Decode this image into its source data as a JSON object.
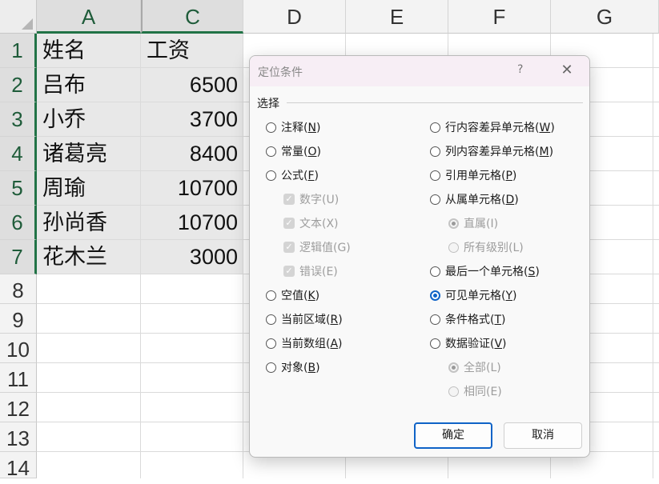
{
  "sheet": {
    "columns": [
      "A",
      "C",
      "D",
      "E",
      "F",
      "G"
    ],
    "rows": [
      "1",
      "2",
      "3",
      "4",
      "5",
      "6",
      "7",
      "8",
      "9",
      "10",
      "11",
      "12",
      "13",
      "14"
    ],
    "data": [
      {
        "name": "姓名",
        "salary": "工资"
      },
      {
        "name": "吕布",
        "salary": "6500"
      },
      {
        "name": "小乔",
        "salary": "3700"
      },
      {
        "name": "诸葛亮",
        "salary": "8400"
      },
      {
        "name": "周瑜",
        "salary": "10700"
      },
      {
        "name": "孙尚香",
        "salary": "10700"
      },
      {
        "name": "花木兰",
        "salary": "3000"
      }
    ]
  },
  "dialog": {
    "title": "定位条件",
    "help": "?",
    "close": "✕",
    "group_label": "选择",
    "left_options": [
      {
        "label": "注释(",
        "key": "N",
        "suffix": ")",
        "type": "radio",
        "checked": false,
        "disabled": false
      },
      {
        "label": "常量(",
        "key": "O",
        "suffix": ")",
        "type": "radio",
        "checked": false,
        "disabled": false
      },
      {
        "label": "公式(",
        "key": "F",
        "suffix": ")",
        "type": "radio",
        "checked": false,
        "disabled": false
      },
      {
        "label": "数字(U)",
        "type": "check",
        "checked": true,
        "disabled": true
      },
      {
        "label": "文本(X)",
        "type": "check",
        "checked": true,
        "disabled": true
      },
      {
        "label": "逻辑值(G)",
        "type": "check",
        "checked": true,
        "disabled": true
      },
      {
        "label": "错误(E)",
        "type": "check",
        "checked": true,
        "disabled": true
      },
      {
        "label": "空值(",
        "key": "K",
        "suffix": ")",
        "type": "radio",
        "checked": false,
        "disabled": false
      },
      {
        "label": "当前区域(",
        "key": "R",
        "suffix": ")",
        "type": "radio",
        "checked": false,
        "disabled": false
      },
      {
        "label": "当前数组(",
        "key": "A",
        "suffix": ")",
        "type": "radio",
        "checked": false,
        "disabled": false
      },
      {
        "label": "对象(",
        "key": "B",
        "suffix": ")",
        "type": "radio",
        "checked": false,
        "disabled": false
      }
    ],
    "right_options": [
      {
        "label": "行内容差异单元格(",
        "key": "W",
        "suffix": ")",
        "type": "radio",
        "checked": false,
        "disabled": false
      },
      {
        "label": "列内容差异单元格(",
        "key": "M",
        "suffix": ")",
        "type": "radio",
        "checked": false,
        "disabled": false
      },
      {
        "label": "引用单元格(",
        "key": "P",
        "suffix": ")",
        "type": "radio",
        "checked": false,
        "disabled": false
      },
      {
        "label": "从属单元格(",
        "key": "D",
        "suffix": ")",
        "type": "radio",
        "checked": false,
        "disabled": false
      },
      {
        "label": "直属(I)",
        "type": "radio",
        "checked": true,
        "disabled": true
      },
      {
        "label": "所有级别(L)",
        "type": "radio",
        "checked": false,
        "disabled": true
      },
      {
        "label": "最后一个单元格(",
        "key": "S",
        "suffix": ")",
        "type": "radio",
        "checked": false,
        "disabled": false
      },
      {
        "label": "可见单元格(",
        "key": "Y",
        "suffix": ")",
        "type": "radio",
        "checked": true,
        "disabled": false
      },
      {
        "label": "条件格式(",
        "key": "T",
        "suffix": ")",
        "type": "radio",
        "checked": false,
        "disabled": false
      },
      {
        "label": "数据验证(",
        "key": "V",
        "suffix": ")",
        "type": "radio",
        "checked": false,
        "disabled": false
      },
      {
        "label": "全部(L)",
        "type": "radio",
        "checked": true,
        "disabled": true
      },
      {
        "label": "相同(E)",
        "type": "radio",
        "checked": false,
        "disabled": true
      }
    ],
    "ok_label": "确定",
    "cancel_label": "取消"
  },
  "colors": {
    "accent": "#0f63c7",
    "header_select": "#217346"
  }
}
